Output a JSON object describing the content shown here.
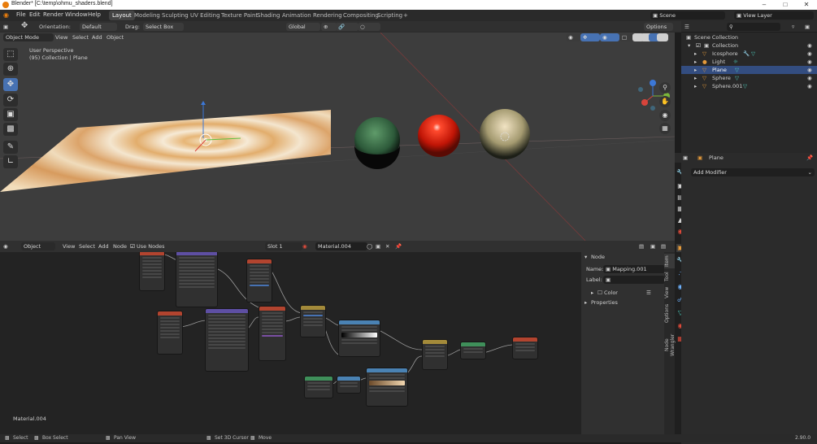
{
  "window": {
    "title": "Blender* [C:\\temp\\ohmu_shaders.blend]",
    "controls": [
      "–",
      "□",
      "✕"
    ]
  },
  "menubar": {
    "items": [
      "File",
      "Edit",
      "Render",
      "Window",
      "Help"
    ],
    "workspaces": [
      "Layout",
      "Modeling",
      "Sculpting",
      "UV Editing",
      "Texture Paint",
      "Shading",
      "Animation",
      "Rendering",
      "Compositing",
      "Scripting"
    ],
    "add_tab": "+",
    "scene": "Scene",
    "view_layer": "View Layer"
  },
  "viewport_header": {
    "mode": "Object Mode",
    "menus": [
      "View",
      "Select",
      "Add",
      "Object"
    ],
    "orientation_label": "Orientation:",
    "orientation_value": "Default",
    "drag_label": "Drag:",
    "drag_value": "Select Box",
    "transform_orientation": "Global",
    "options": "Options"
  },
  "viewport": {
    "perspective": "User Perspective",
    "collection_info": "(95) Collection | Plane",
    "axes": {
      "x": "X",
      "y": "Y",
      "z": "Z"
    }
  },
  "outliner": {
    "root": "Scene Collection",
    "collection": "Collection",
    "items": [
      {
        "name": "Icosphore"
      },
      {
        "name": "Light"
      },
      {
        "name": "Plane"
      },
      {
        "name": "Sphere"
      },
      {
        "name": "Sphere.001"
      }
    ]
  },
  "properties": {
    "object_name": "Plane",
    "add_modifier": "Add Modifier"
  },
  "node_header": {
    "editor": "Object",
    "menus": [
      "View",
      "Select",
      "Add",
      "Node"
    ],
    "use_nodes": "Use Nodes",
    "slot": "Slot 1",
    "material": "Material.004"
  },
  "node_editor": {
    "material_label": "Material.004"
  },
  "node_panel": {
    "section": "Node",
    "name_label": "Name:",
    "name_value": "Mapping.001",
    "label_label": "Label:",
    "label_value": "",
    "color": "Color",
    "properties": "Properties",
    "tabs": [
      "Item",
      "Tool",
      "View",
      "Options",
      "Node Wrangler"
    ]
  },
  "statusbar": {
    "items": [
      "Select",
      "Box Select",
      "Pan View",
      "Set 3D Cursor",
      "Move"
    ],
    "version": "2.90.0"
  },
  "colors": {
    "accent": "#4772b3",
    "active_row": "#334d80",
    "header": "#303030",
    "viewport_bg": "#3d3d3d"
  }
}
